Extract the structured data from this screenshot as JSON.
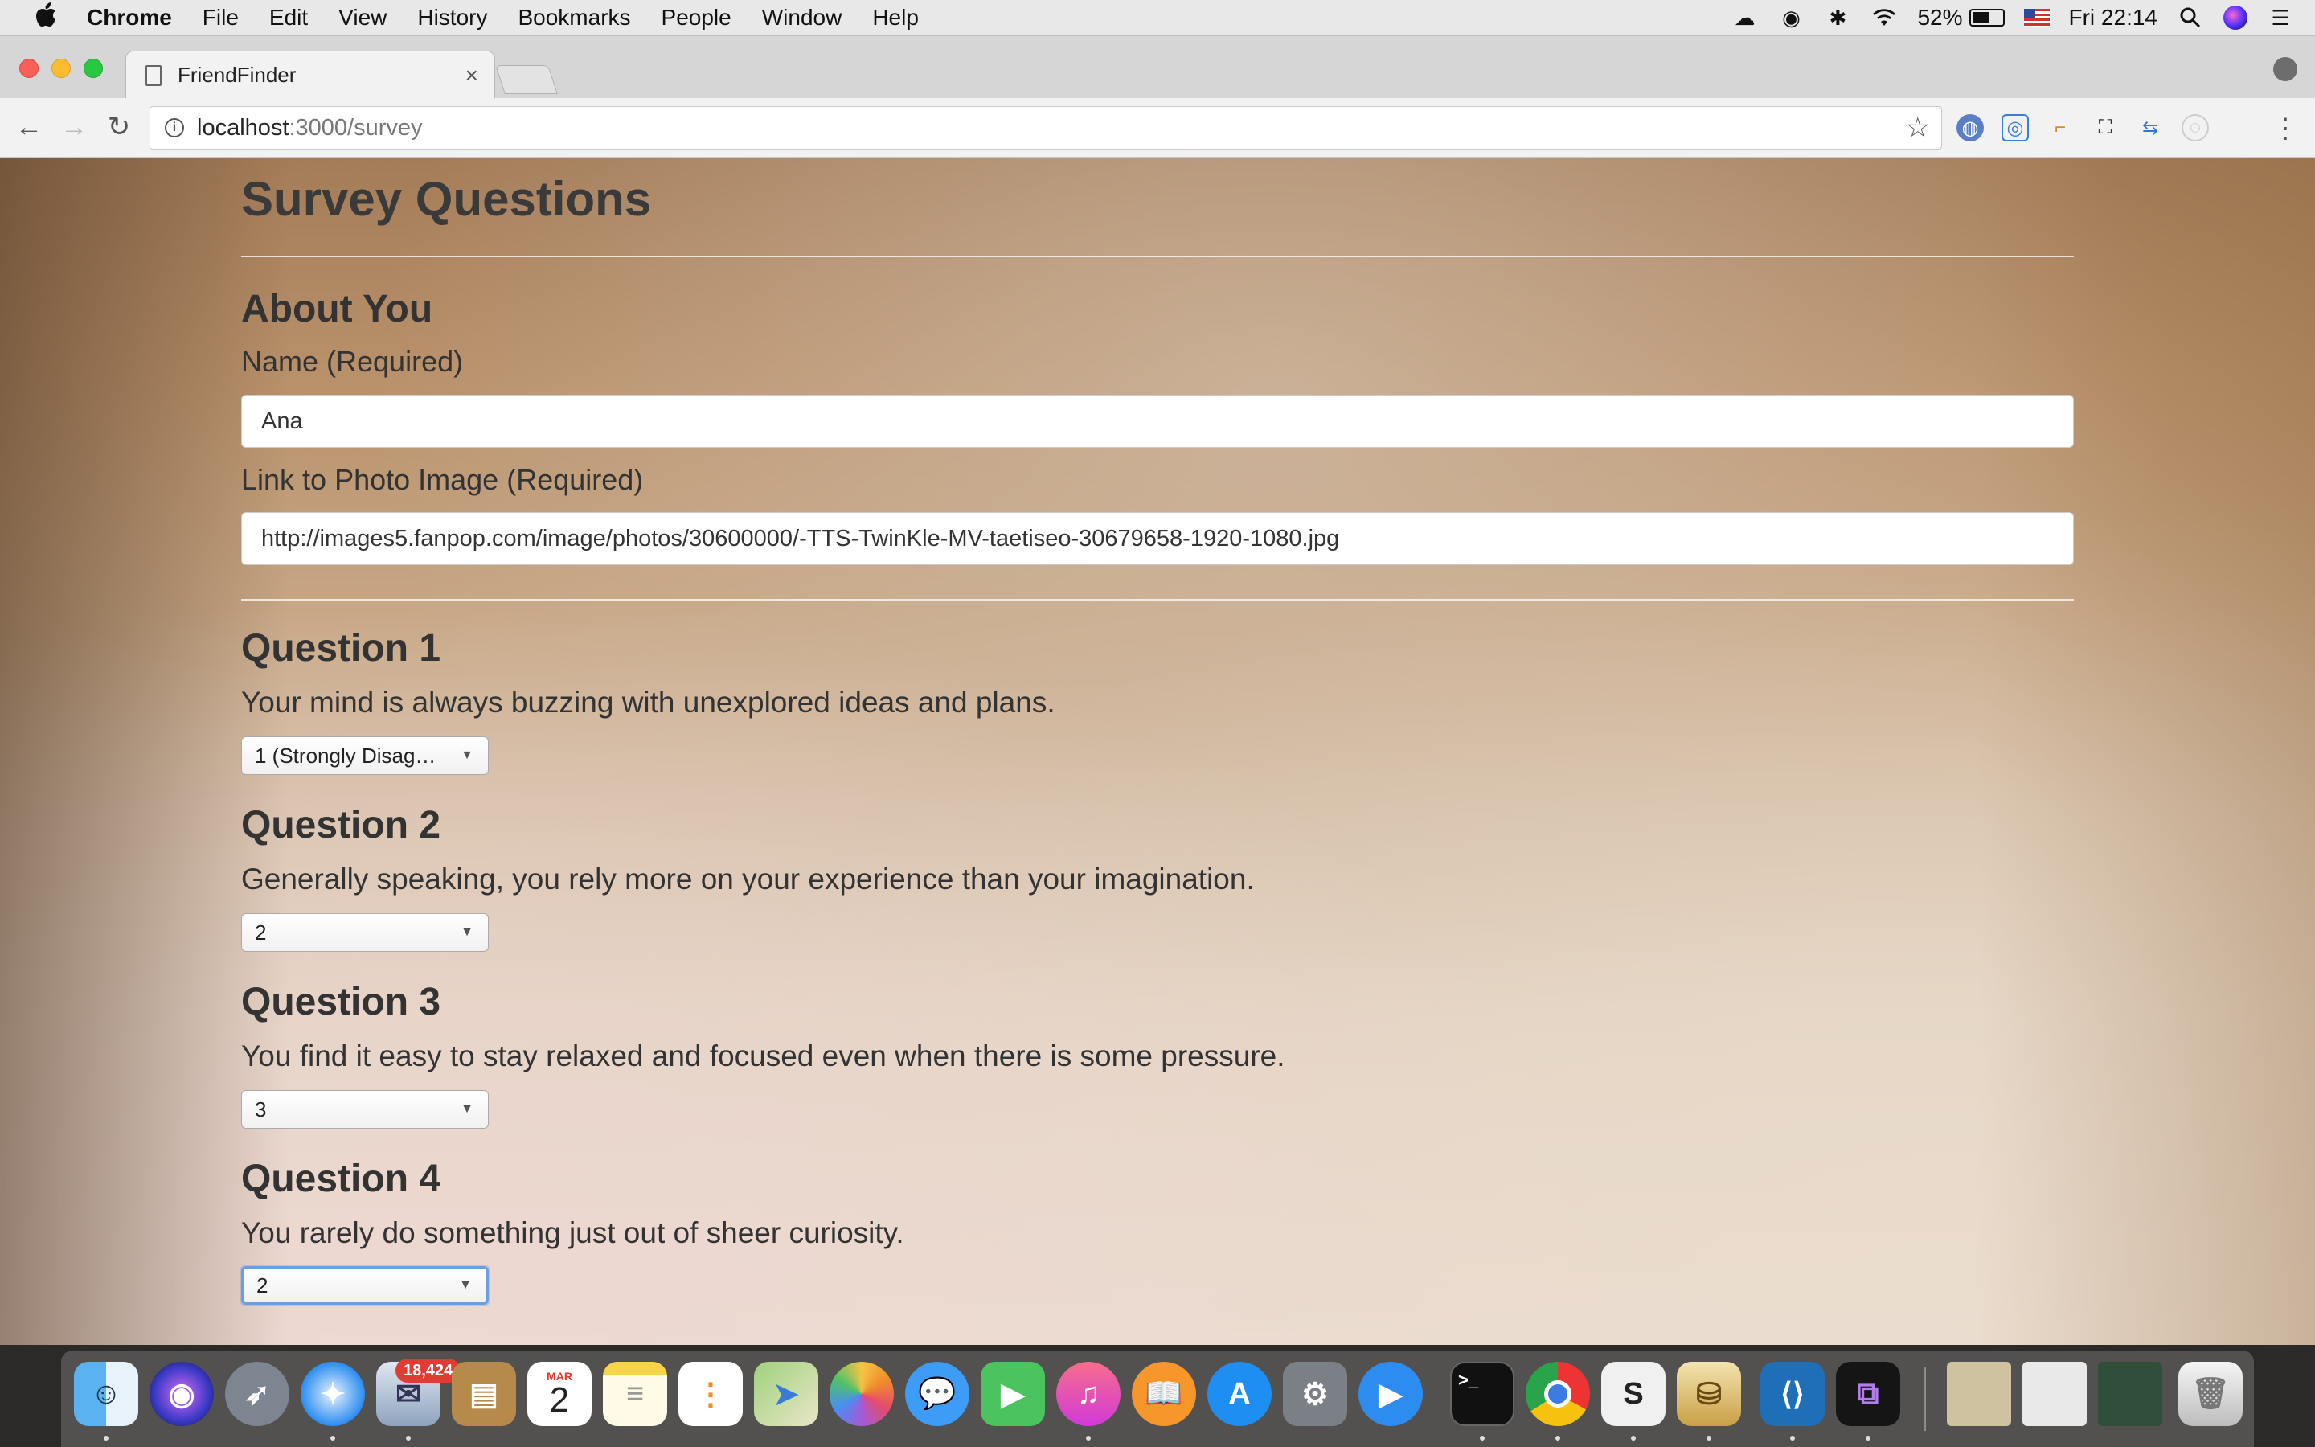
{
  "menubar": {
    "app": "Chrome",
    "items": [
      "File",
      "Edit",
      "View",
      "History",
      "Bookmarks",
      "People",
      "Window",
      "Help"
    ],
    "battery": "52%",
    "clock": "Fri 22:14"
  },
  "browser": {
    "tab_title": "FriendFinder",
    "url_host": "localhost",
    "url_path": ":3000/survey"
  },
  "survey": {
    "title": "Survey Questions",
    "about_heading": "About You",
    "name_label": "Name (Required)",
    "name_value": "Ana",
    "photo_label": "Link to Photo Image (Required)",
    "photo_value": "http://images5.fanpop.com/image/photos/30600000/-TTS-TwinKle-MV-taetiseo-30679658-1920-1080.jpg",
    "questions": [
      {
        "title": "Question 1",
        "text": "Your mind is always buzzing with unexplored ideas and plans.",
        "selected": "1 (Strongly Disagree)"
      },
      {
        "title": "Question 2",
        "text": "Generally speaking, you rely more on your experience than your imagination.",
        "selected": "2"
      },
      {
        "title": "Question 3",
        "text": "You find it easy to stay relaxed and focused even when there is some pressure.",
        "selected": "3"
      },
      {
        "title": "Question 4",
        "text": "You rarely do something just out of sheer curiosity.",
        "selected": "2"
      }
    ]
  },
  "dock": {
    "mail_badge": "18,424",
    "calendar_month": "MAR",
    "calendar_day": "2"
  },
  "colors": {
    "text": "#333333",
    "focus": "#6a9fe0",
    "badge": "#e23b33"
  }
}
